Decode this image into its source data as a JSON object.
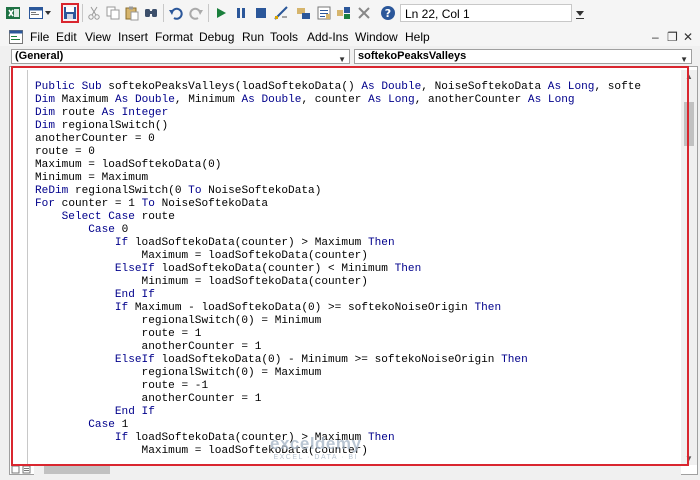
{
  "toolbar": {
    "status": "Ln 22, Col 1",
    "icons": [
      "excel-icon",
      "insert-module-icon",
      "save-icon",
      "cut-icon",
      "copy-icon",
      "paste-icon",
      "find-icon",
      "undo-icon",
      "redo-icon",
      "run-icon",
      "break-icon",
      "reset-icon",
      "design-mode-icon",
      "project-explorer-icon",
      "properties-icon",
      "object-browser-icon",
      "toolbox-icon",
      "help-icon"
    ],
    "highlight_color": "#d9262f"
  },
  "menubar": {
    "items": [
      "File",
      "Edit",
      "View",
      "Insert",
      "Format",
      "Debug",
      "Run",
      "Tools",
      "Add-Ins",
      "Window",
      "Help"
    ],
    "window_controls": [
      "–",
      "❐",
      "✕"
    ]
  },
  "object_combo": {
    "value": "(General)"
  },
  "procedure_combo": {
    "value": "softekoPeaksValleys"
  },
  "code": {
    "lines": [
      "Public Sub softekoPeaksValleys(loadSoftekoData() As Double, NoiseSoftekoData As Long, softe",
      "Dim Maximum As Double, Minimum As Double, counter As Long, anotherCounter As Long",
      "Dim route As Integer",
      "Dim regionalSwitch()",
      "anotherCounter = 0",
      "route = 0",
      "Maximum = loadSoftekoData(0)",
      "Minimum = Maximum",
      "ReDim regionalSwitch(0 To NoiseSoftekoData)",
      "For counter = 1 To NoiseSoftekoData",
      "    Select Case route",
      "        Case 0",
      "            If loadSoftekoData(counter) > Maximum Then",
      "                Maximum = loadSoftekoData(counter)",
      "            ElseIf loadSoftekoData(counter) < Minimum Then",
      "                Minimum = loadSoftekoData(counter)",
      "            End If",
      "            If Maximum - loadSoftekoData(0) >= softekoNoiseOrigin Then",
      "                regionalSwitch(0) = Minimum",
      "                route = 1",
      "                anotherCounter = 1",
      "            ElseIf loadSoftekoData(0) - Minimum >= softekoNoiseOrigin Then",
      "                regionalSwitch(0) = Maximum",
      "                route = -1",
      "                anotherCounter = 1",
      "            End If",
      "        Case 1",
      "            If loadSoftekoData(counter) > Maximum Then",
      "                Maximum = loadSoftekoData(counter)"
    ],
    "keywords": [
      "Public",
      "Sub",
      "As",
      "Double",
      "Long",
      "Dim",
      "Integer",
      "ReDim",
      "To",
      "For",
      "Select",
      "Case",
      "If",
      "Then",
      "ElseIf",
      "End"
    ],
    "keyword_color": "#00008b"
  },
  "watermark": {
    "main": "exceldemy",
    "sub": "EXCEL · DATA · BI"
  }
}
